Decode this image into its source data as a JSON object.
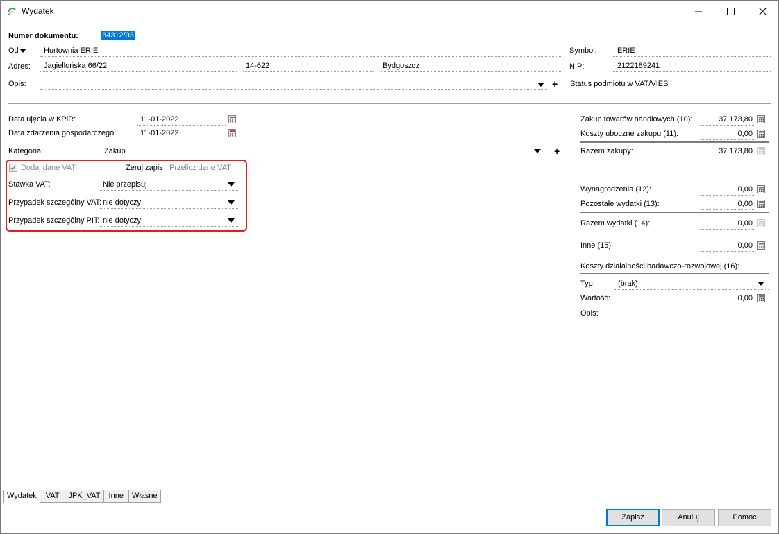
{
  "window": {
    "title": "Wydatek"
  },
  "header": {
    "doc_number_label": "Numer dokumentu:",
    "doc_number_value": "34312/03",
    "from_label": "Od",
    "from_value": "Hurtownia ERIE",
    "symbol_label": "Symbol:",
    "symbol_value": "ERIE",
    "address_label": "Adres:",
    "street": "Jagiellońska  66/22",
    "postal_code": "14-622",
    "city": "Bydgoszcz",
    "nip_label": "NIP:",
    "nip_value": "2122189241",
    "desc_label": "Opis:",
    "desc_value": "",
    "vat_status_link": "Status podmiotu w VAT/VIES"
  },
  "left": {
    "kpir_date_label": "Data ujęcia w KPiR:",
    "kpir_date_value": "11-01-2022",
    "event_date_label": "Data zdarzenia gospodarczego:",
    "event_date_value": "11-01-2022",
    "category_label": "Kategoria:",
    "category_value": "Zakup",
    "add_vat_label": "Dodaj dane VAT",
    "add_vat_checked": true,
    "reset_link": "Zeruj zapis",
    "recalc_link": "Przelicz dane VAT",
    "vat_rate_label": "Stawka VAT:",
    "vat_rate_value": "Nie przepisuj",
    "special_vat_label": "Przypadek szczególny VAT:",
    "special_vat_value": "nie dotyczy",
    "special_pit_label": "Przypadek szczególny PIT:",
    "special_pit_value": "nie dotyczy"
  },
  "right": {
    "goods_label": "Zakup towarów handlowych (10):",
    "goods_value": "37 173,80",
    "side_costs_label": "Koszty uboczne zakupu (11):",
    "side_costs_value": "0,00",
    "total_purchase_label": "Razem zakupy:",
    "total_purchase_value": "37 173,80",
    "salaries_label": "Wynagrodzenia (12):",
    "salaries_value": "0,00",
    "other_expenses_label": "Pozostałe wydatki (13):",
    "other_expenses_value": "0,00",
    "total_expenses_label": "Razem wydatki (14):",
    "total_expenses_value": "0,00",
    "other_label": "Inne (15):",
    "other_value": "0,00",
    "rnd_label": "Koszty działalności badawczo-rozwojowej (16):",
    "type_label": "Typ:",
    "type_value": "(brak)",
    "amount_label": "Wartość:",
    "amount_value": "0,00",
    "rnd_desc_label": "Opis:"
  },
  "tabs": [
    "Wydatek",
    "VAT",
    "JPK_VAT",
    "Inne",
    "Własne"
  ],
  "buttons": {
    "save": "Zapisz",
    "cancel": "Anuluj",
    "help": "Pomoc"
  },
  "colors": {
    "highlight": "#e0201a",
    "selection": "#0078d7"
  }
}
